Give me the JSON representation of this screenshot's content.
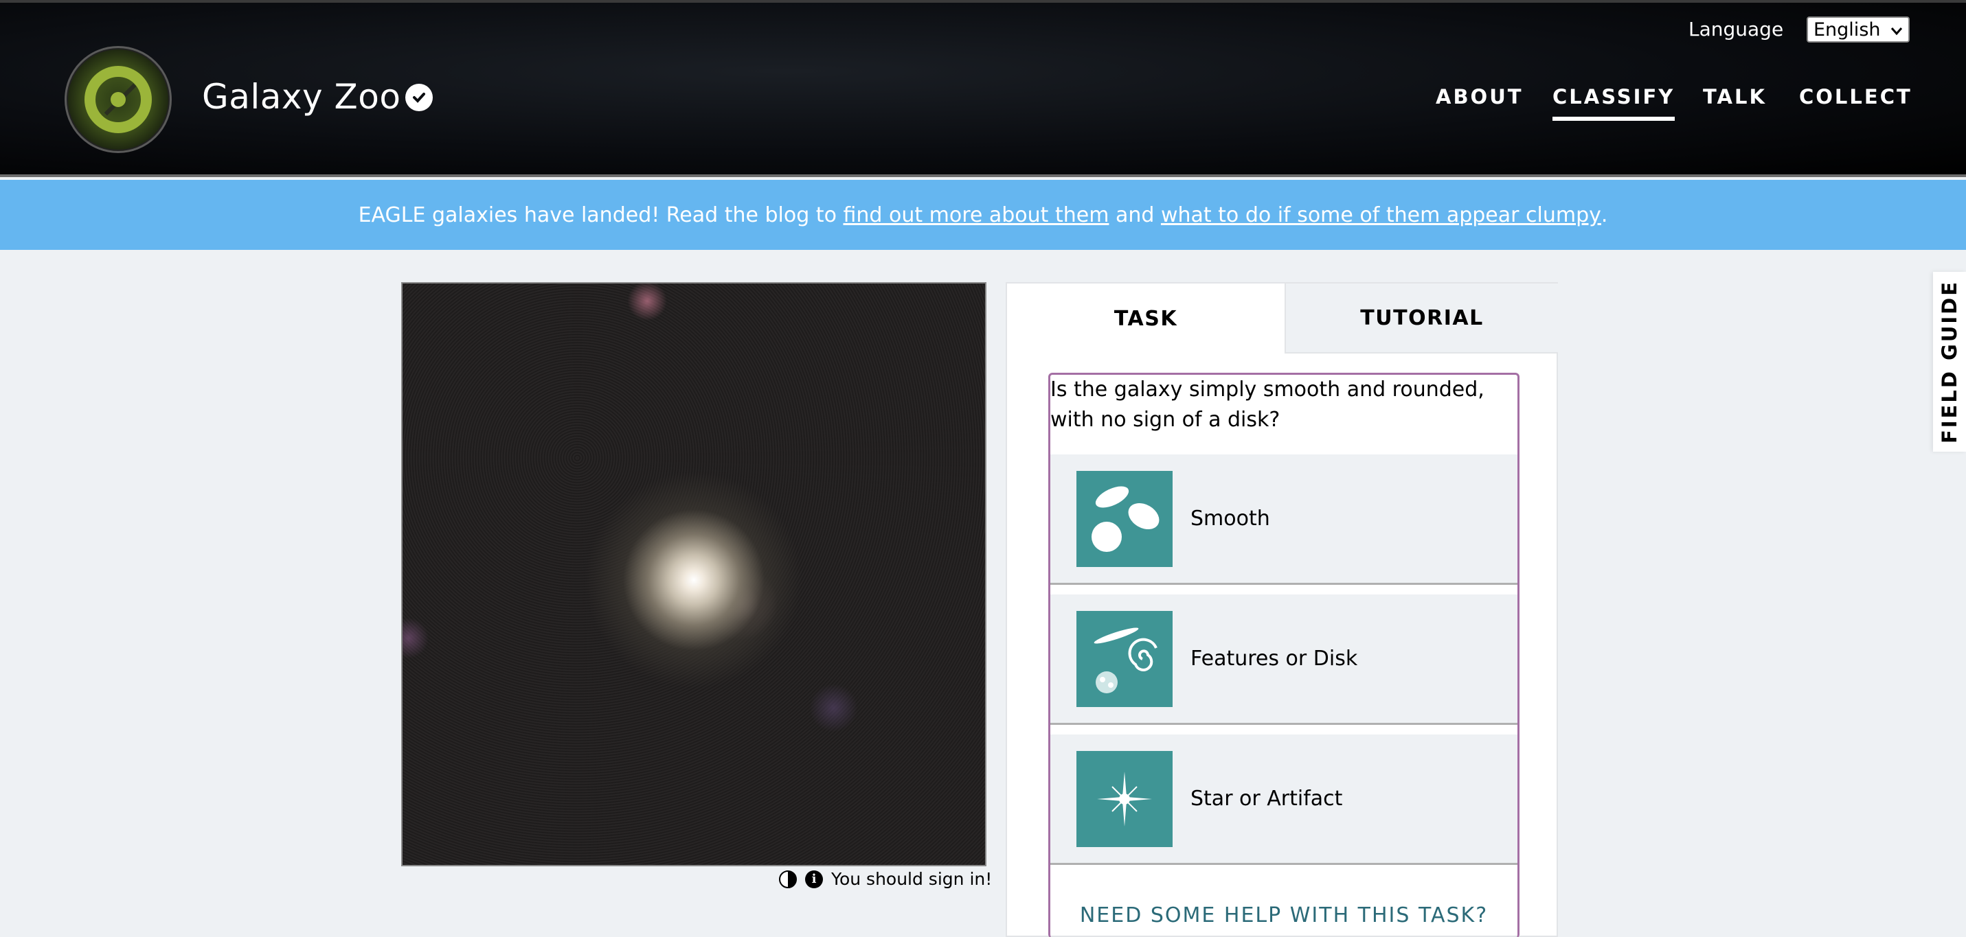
{
  "header": {
    "site_title": "Galaxy Zoo",
    "language_label": "Language",
    "language_value": "English",
    "nav": [
      "ABOUT",
      "CLASSIFY",
      "TALK",
      "COLLECT"
    ],
    "active_nav": "CLASSIFY"
  },
  "banner": {
    "text_before": "EAGLE galaxies have landed! Read the blog to ",
    "link1": "find out more about them",
    "text_mid": " and ",
    "link2": "what to do if some of them appear clumpy",
    "text_after": "."
  },
  "subject": {
    "sign_in_text": "You should sign in!"
  },
  "panel": {
    "tabs": [
      "TASK",
      "TUTORIAL"
    ],
    "question": "Is the galaxy simply smooth and rounded, with no sign of a disk?",
    "answers": [
      "Smooth",
      "Features or Disk",
      "Star or Artifact"
    ],
    "help": "NEED SOME HELP WITH THIS TASK?"
  },
  "field_guide": "FIELD GUIDE",
  "colors": {
    "banner": "#65b6f0",
    "task_border": "#a46fa4",
    "answer_icon_bg": "#3f9595",
    "help_text": "#2b6a78"
  }
}
